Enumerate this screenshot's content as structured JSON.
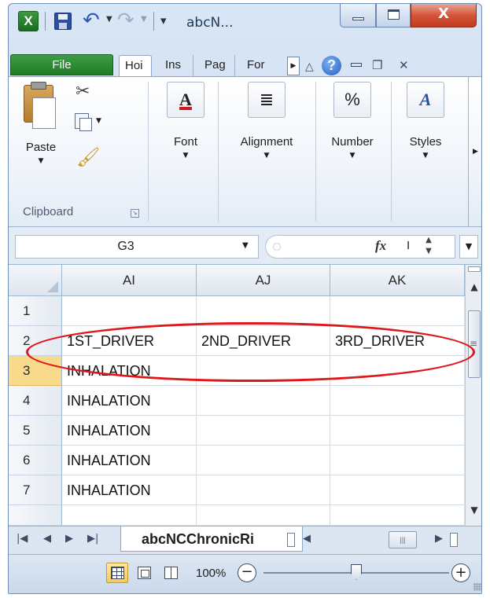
{
  "window": {
    "title": "abcN...",
    "close_glyph": "X",
    "colors": {
      "file_tab": "#2a8a31",
      "close_button": "#d4553a",
      "annotation": "#e0171a",
      "selected_row_header": "#f9d98a"
    }
  },
  "quick_access": {
    "icons": [
      "excel-logo-icon",
      "save-icon",
      "undo-icon",
      "redo-icon",
      "customize-icon"
    ],
    "logo_letter": "X"
  },
  "ribbon_tabs": {
    "file": "File",
    "tabs": [
      {
        "label": "Hoi",
        "active": true
      },
      {
        "label": "Ins",
        "active": false
      },
      {
        "label": "Pag",
        "active": false
      },
      {
        "label": "For",
        "active": false
      }
    ],
    "help": "?"
  },
  "ribbon": {
    "clipboard": {
      "paste": "Paste",
      "group_label": "Clipboard"
    },
    "buttons": [
      {
        "id": "font",
        "label": "Font",
        "icon": "A"
      },
      {
        "id": "alignment",
        "label": "Alignment",
        "icon": "≣"
      },
      {
        "id": "number",
        "label": "Number",
        "icon": "%"
      },
      {
        "id": "styles",
        "label": "Styles",
        "icon": "A"
      }
    ]
  },
  "formula_bar": {
    "name_box": "G3",
    "fx": "fx",
    "content": "I"
  },
  "grid": {
    "columns": [
      "AI",
      "AJ",
      "AK"
    ],
    "selected_row": "3",
    "rows": [
      {
        "header": "1",
        "cells": [
          "",
          "",
          ""
        ]
      },
      {
        "header": "2",
        "cells": [
          "1ST_DRIVER",
          "2ND_DRIVER",
          "3RD_DRIVER"
        ]
      },
      {
        "header": "3",
        "cells": [
          "INHALATION",
          "",
          ""
        ]
      },
      {
        "header": "4",
        "cells": [
          "INHALATION",
          "",
          ""
        ]
      },
      {
        "header": "5",
        "cells": [
          "INHALATION",
          "",
          ""
        ]
      },
      {
        "header": "6",
        "cells": [
          "INHALATION",
          "",
          ""
        ]
      },
      {
        "header": "7",
        "cells": [
          "INHALATION",
          "",
          ""
        ]
      }
    ]
  },
  "sheet_tabs": {
    "active": "abcNCChronicRi"
  },
  "status_bar": {
    "zoom": "100%",
    "zoom_level_fraction": 0.5
  }
}
